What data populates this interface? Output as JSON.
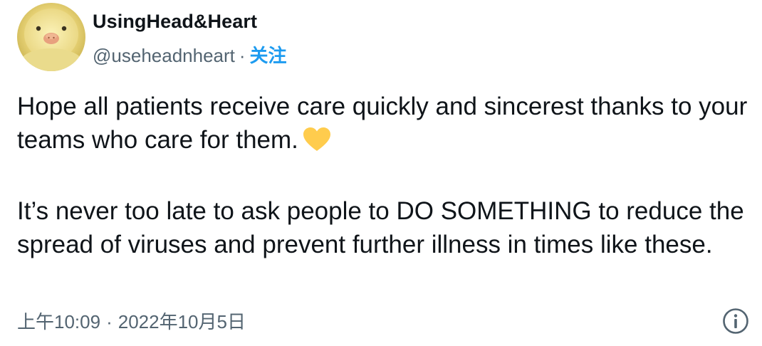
{
  "author": {
    "display_name": "UsingHead&Heart",
    "handle": "@useheadnheart",
    "separator": "·",
    "follow_label": "关注",
    "avatar_icon": "duckling-avatar"
  },
  "tweet": {
    "paragraph_1": "Hope all patients receive care quickly and sincerest thanks to your teams who care for them.",
    "paragraph_1_emoji": "yellow-heart",
    "paragraph_2": "It’s never too late to ask people to DO SOMETHING to reduce the spread of viruses and prevent further illness in times like these."
  },
  "meta": {
    "time": "上午10:09",
    "separator": "·",
    "date": "2022年10月5日",
    "info_icon": "info-icon"
  },
  "colors": {
    "text": "#0f1419",
    "secondary": "#536471",
    "accent": "#1d9bf0",
    "heart": "#ffcc4d"
  }
}
